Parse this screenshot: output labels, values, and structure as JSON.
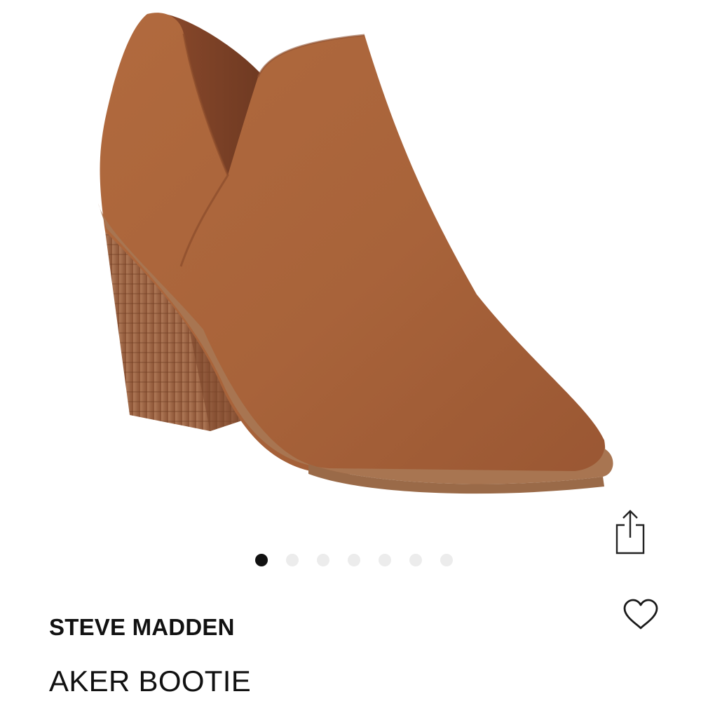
{
  "product": {
    "brand": "STEVE MADDEN",
    "name": "AKER BOOTIE",
    "image_alt": "Aker Bootie in cognac suede"
  },
  "gallery": {
    "image_count": 7,
    "active_index": 0
  },
  "icons": {
    "share": "share-icon",
    "favorite": "heart-icon"
  },
  "colors": {
    "boot_suede": "#a9643a",
    "sole": "#a87551",
    "heel_wood": "#9c5f3c",
    "dot_active": "#111111",
    "dot_inactive": "#ececec"
  }
}
